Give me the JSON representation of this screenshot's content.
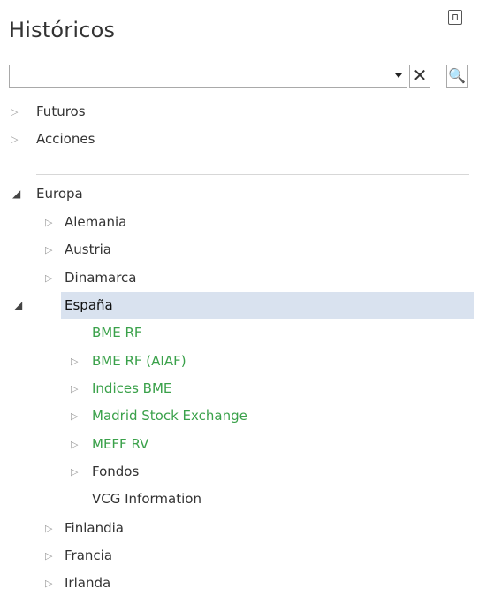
{
  "panel": {
    "title": "Históricos",
    "pin_icon": "pin-icon"
  },
  "search": {
    "value": "",
    "placeholder": ""
  },
  "toolbar": {
    "clear_glyph": "✕",
    "search_glyph": "🔍"
  },
  "tree": {
    "collapsed_glyph": "▷",
    "expanded_glyph": "◢",
    "top_items": [
      {
        "label": "Futuros",
        "state": "collapsed"
      },
      {
        "label": "Acciones",
        "state": "collapsed"
      }
    ],
    "europa": {
      "label": "Europa",
      "state": "expanded"
    },
    "countries_before": [
      {
        "label": "Alemania",
        "state": "collapsed"
      },
      {
        "label": "Austria",
        "state": "collapsed"
      },
      {
        "label": "Dinamarca",
        "state": "collapsed"
      }
    ],
    "espana": {
      "label": "España",
      "state": "expanded",
      "selected": true
    },
    "espana_children": [
      {
        "label": "BME RF",
        "state": "leaf",
        "color": "#3aa14a"
      },
      {
        "label": "BME RF (AIAF)",
        "state": "collapsed",
        "color": "#3aa14a"
      },
      {
        "label": "Indices BME",
        "state": "collapsed",
        "color": "#3aa14a"
      },
      {
        "label": "Madrid Stock Exchange",
        "state": "collapsed",
        "color": "#3aa14a"
      },
      {
        "label": "MEFF RV",
        "state": "collapsed",
        "color": "#3aa14a"
      },
      {
        "label": "Fondos",
        "state": "collapsed",
        "color": "#333333"
      },
      {
        "label": "VCG Information",
        "state": "leaf",
        "color": "#333333"
      }
    ],
    "countries_after": [
      {
        "label": "Finlandia",
        "state": "collapsed"
      },
      {
        "label": "Francia",
        "state": "collapsed"
      },
      {
        "label": "Irlanda",
        "state": "collapsed"
      }
    ]
  },
  "colors": {
    "selection": "#d9e2ef",
    "link_green": "#3aa14a",
    "text": "#333333"
  }
}
